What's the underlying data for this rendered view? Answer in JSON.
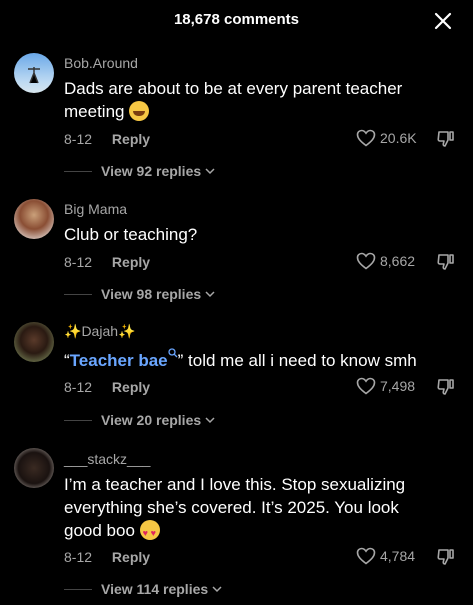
{
  "header": {
    "title": "18,678 comments"
  },
  "comments": [
    {
      "username": "Bob.Around",
      "text": "Dads are about to be at every parent teacher meeting",
      "date": "8-12",
      "reply_label": "Reply",
      "likes": "20.6K",
      "view_replies": "View 92 replies"
    },
    {
      "username": "Big Mama",
      "text": "Club or teaching?",
      "date": "8-12",
      "reply_label": "Reply",
      "likes": "8,662",
      "view_replies": "View 98 replies"
    },
    {
      "username": "Dajah",
      "text_prefix": "“",
      "tag": "Teacher bae",
      "text_suffix": "” told me all i need to know smh",
      "date": "8-12",
      "reply_label": "Reply",
      "likes": "7,498",
      "view_replies": "View 20 replies"
    },
    {
      "username": "___stackz___",
      "text": "I’m a teacher and I love this. Stop sexualizing everything she’s covered. It’s 2025. You look good boo",
      "date": "8-12",
      "reply_label": "Reply",
      "likes": "4,784",
      "view_replies": "View 114 replies"
    }
  ]
}
